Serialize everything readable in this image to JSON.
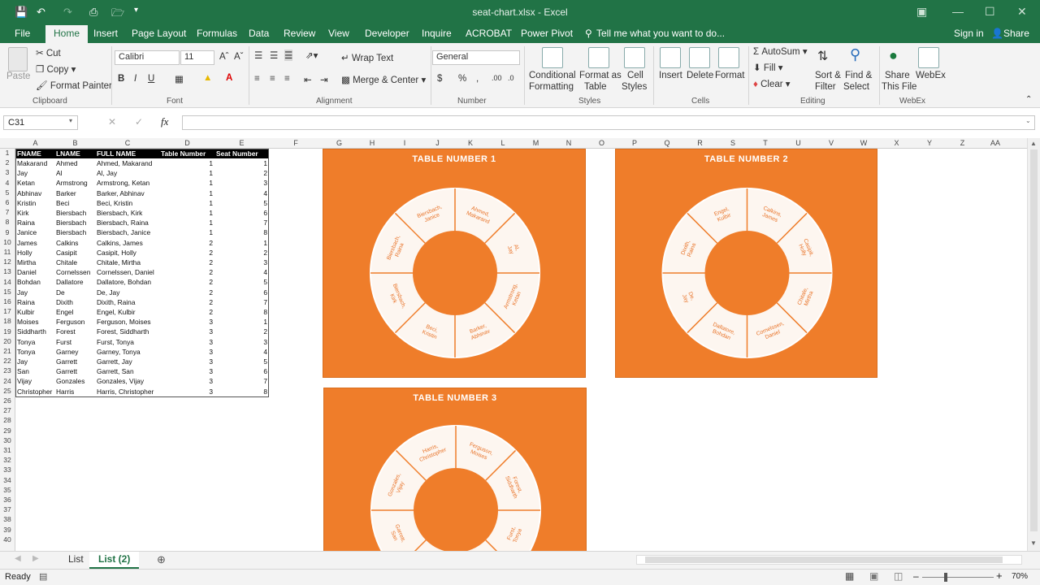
{
  "window": {
    "title": "seat-chart.xlsx - Excel"
  },
  "menu": {
    "tabs": [
      "File",
      "Home",
      "Insert",
      "Page Layout",
      "Formulas",
      "Data",
      "Review",
      "View",
      "Developer",
      "Inquire",
      "ACROBAT",
      "Power Pivot"
    ],
    "tell_me": "Tell me what you want to do...",
    "sign_in": "Sign in",
    "share": "Share"
  },
  "ribbon": {
    "clipboard": {
      "paste": "Paste",
      "cut": "Cut",
      "copy": "Copy",
      "format_painter": "Format Painter",
      "label": "Clipboard"
    },
    "font": {
      "name": "Calibri",
      "size": "11",
      "label": "Font",
      "bold": "B",
      "italic": "I",
      "underline": "U"
    },
    "alignment": {
      "wrap": "Wrap Text",
      "merge": "Merge & Center",
      "label": "Alignment"
    },
    "number": {
      "format": "General",
      "label": "Number",
      "currency": "$",
      "percent": "%",
      "comma": ","
    },
    "styles": {
      "conditional": "Conditional",
      "conditional2": "Formatting",
      "format_table": "Format as",
      "format_table2": "Table",
      "cell_styles": "Cell",
      "cell_styles2": "Styles",
      "label": "Styles"
    },
    "cells": {
      "insert": "Insert",
      "delete": "Delete",
      "format": "Format",
      "label": "Cells"
    },
    "editing": {
      "autosum": "AutoSum",
      "fill": "Fill",
      "clear": "Clear",
      "sort": "Sort &",
      "sort2": "Filter",
      "find": "Find &",
      "find2": "Select",
      "label": "Editing"
    },
    "webex": {
      "share": "Share",
      "share2": "This File",
      "webex": "WebEx",
      "label": "WebEx"
    }
  },
  "formula_bar": {
    "name_box": "C31",
    "fx": "fx",
    "formula": ""
  },
  "columns": [
    "A",
    "B",
    "C",
    "D",
    "E",
    "F",
    "G",
    "H",
    "I",
    "J",
    "K",
    "L",
    "M",
    "N",
    "O",
    "P",
    "Q",
    "R",
    "S",
    "T",
    "U",
    "V",
    "W",
    "X",
    "Y",
    "Z",
    "AA"
  ],
  "rows": [
    "1",
    "2",
    "3",
    "4",
    "5",
    "6",
    "7",
    "8",
    "9",
    "10",
    "11",
    "12",
    "13",
    "14",
    "15",
    "16",
    "17",
    "18",
    "19",
    "20",
    "21",
    "22",
    "23",
    "24",
    "25",
    "26",
    "27",
    "28",
    "29",
    "30",
    "31",
    "32",
    "33",
    "34",
    "35",
    "36",
    "37",
    "38",
    "39",
    "40"
  ],
  "table": {
    "headers": [
      "FNAME",
      "LNAME",
      "FULL NAME",
      "Table Number",
      "Seat Number"
    ],
    "rows": [
      [
        "Makarand",
        "Ahmed",
        "Ahmed, Makarand",
        "1",
        "1"
      ],
      [
        "Jay",
        "Al",
        "Al, Jay",
        "1",
        "2"
      ],
      [
        "Ketan",
        "Armstrong",
        "Armstrong, Ketan",
        "1",
        "3"
      ],
      [
        "Abhinav",
        "Barker",
        "Barker, Abhinav",
        "1",
        "4"
      ],
      [
        "Kristin",
        "Beci",
        "Beci, Kristin",
        "1",
        "5"
      ],
      [
        "Kirk",
        "Biersbach",
        "Biersbach, Kirk",
        "1",
        "6"
      ],
      [
        "Raina",
        "Biersbach",
        "Biersbach, Raina",
        "1",
        "7"
      ],
      [
        "Janice",
        "Biersbach",
        "Biersbach, Janice",
        "1",
        "8"
      ],
      [
        "James",
        "Calkins",
        "Calkins, James",
        "2",
        "1"
      ],
      [
        "Holly",
        "Casipit",
        "Casipit, Holly",
        "2",
        "2"
      ],
      [
        "Mirtha",
        "Chitale",
        "Chitale, Mirtha",
        "2",
        "3"
      ],
      [
        "Daniel",
        "Cornelssen",
        "Cornelssen, Daniel",
        "2",
        "4"
      ],
      [
        "Bohdan",
        "Dallatore",
        "Dallatore, Bohdan",
        "2",
        "5"
      ],
      [
        "Jay",
        "De",
        "De, Jay",
        "2",
        "6"
      ],
      [
        "Raina",
        "Dixith",
        "Dixith, Raina",
        "2",
        "7"
      ],
      [
        "Kulbir",
        "Engel",
        "Engel, Kulbir",
        "2",
        "8"
      ],
      [
        "Moises",
        "Ferguson",
        "Ferguson, Moises",
        "3",
        "1"
      ],
      [
        "Siddharth",
        "Forest",
        "Forest, Siddharth",
        "3",
        "2"
      ],
      [
        "Tonya",
        "Furst",
        "Furst, Tonya",
        "3",
        "3"
      ],
      [
        "Tonya",
        "Garney",
        "Garney, Tonya",
        "3",
        "4"
      ],
      [
        "Jay",
        "Garrett",
        "Garrett, Jay",
        "3",
        "5"
      ],
      [
        "San",
        "Garrett",
        "Garrett, San",
        "3",
        "6"
      ],
      [
        "Vijay",
        "Gonzales",
        "Gonzales, Vijay",
        "3",
        "7"
      ],
      [
        "Christopher",
        "Harris",
        "Harris, Christopher",
        "3",
        "8"
      ]
    ]
  },
  "charts": [
    {
      "title": "TABLE NUMBER 1",
      "seats": [
        "Ahmed, Makarand",
        "Al, Jay",
        "Armstrong, Ketan",
        "Barker, Abhinav",
        "Beci, Kristin",
        "Biersbach, Kirk",
        "Biersbach, Raina",
        "Biersbach, Janice"
      ]
    },
    {
      "title": "TABLE NUMBER 2",
      "seats": [
        "Calkins, James",
        "Casipit, Holly",
        "Chitale, Mirtha",
        "Cornelssen, Daniel",
        "Dallatore, Bohdan",
        "De, Jay",
        "Dixith, Raina",
        "Engel, Kulbir"
      ]
    },
    {
      "title": "TABLE NUMBER 3",
      "seats": [
        "Ferguson, Moises",
        "Forest, Siddharth",
        "Furst, Tonya",
        "",
        "",
        "Garrett, San",
        "Gonzales, Vijay",
        "Harris, Christopher"
      ]
    }
  ],
  "sheets": {
    "tabs": [
      "List",
      "List (2)"
    ],
    "active": "List (2)"
  },
  "status": {
    "ready": "Ready",
    "zoom": "70%"
  },
  "colors": {
    "excel_green": "#217346",
    "orange": "#ef7d2a",
    "seat_fill": "#fdf6f0",
    "seat_text": "#e8742a"
  }
}
